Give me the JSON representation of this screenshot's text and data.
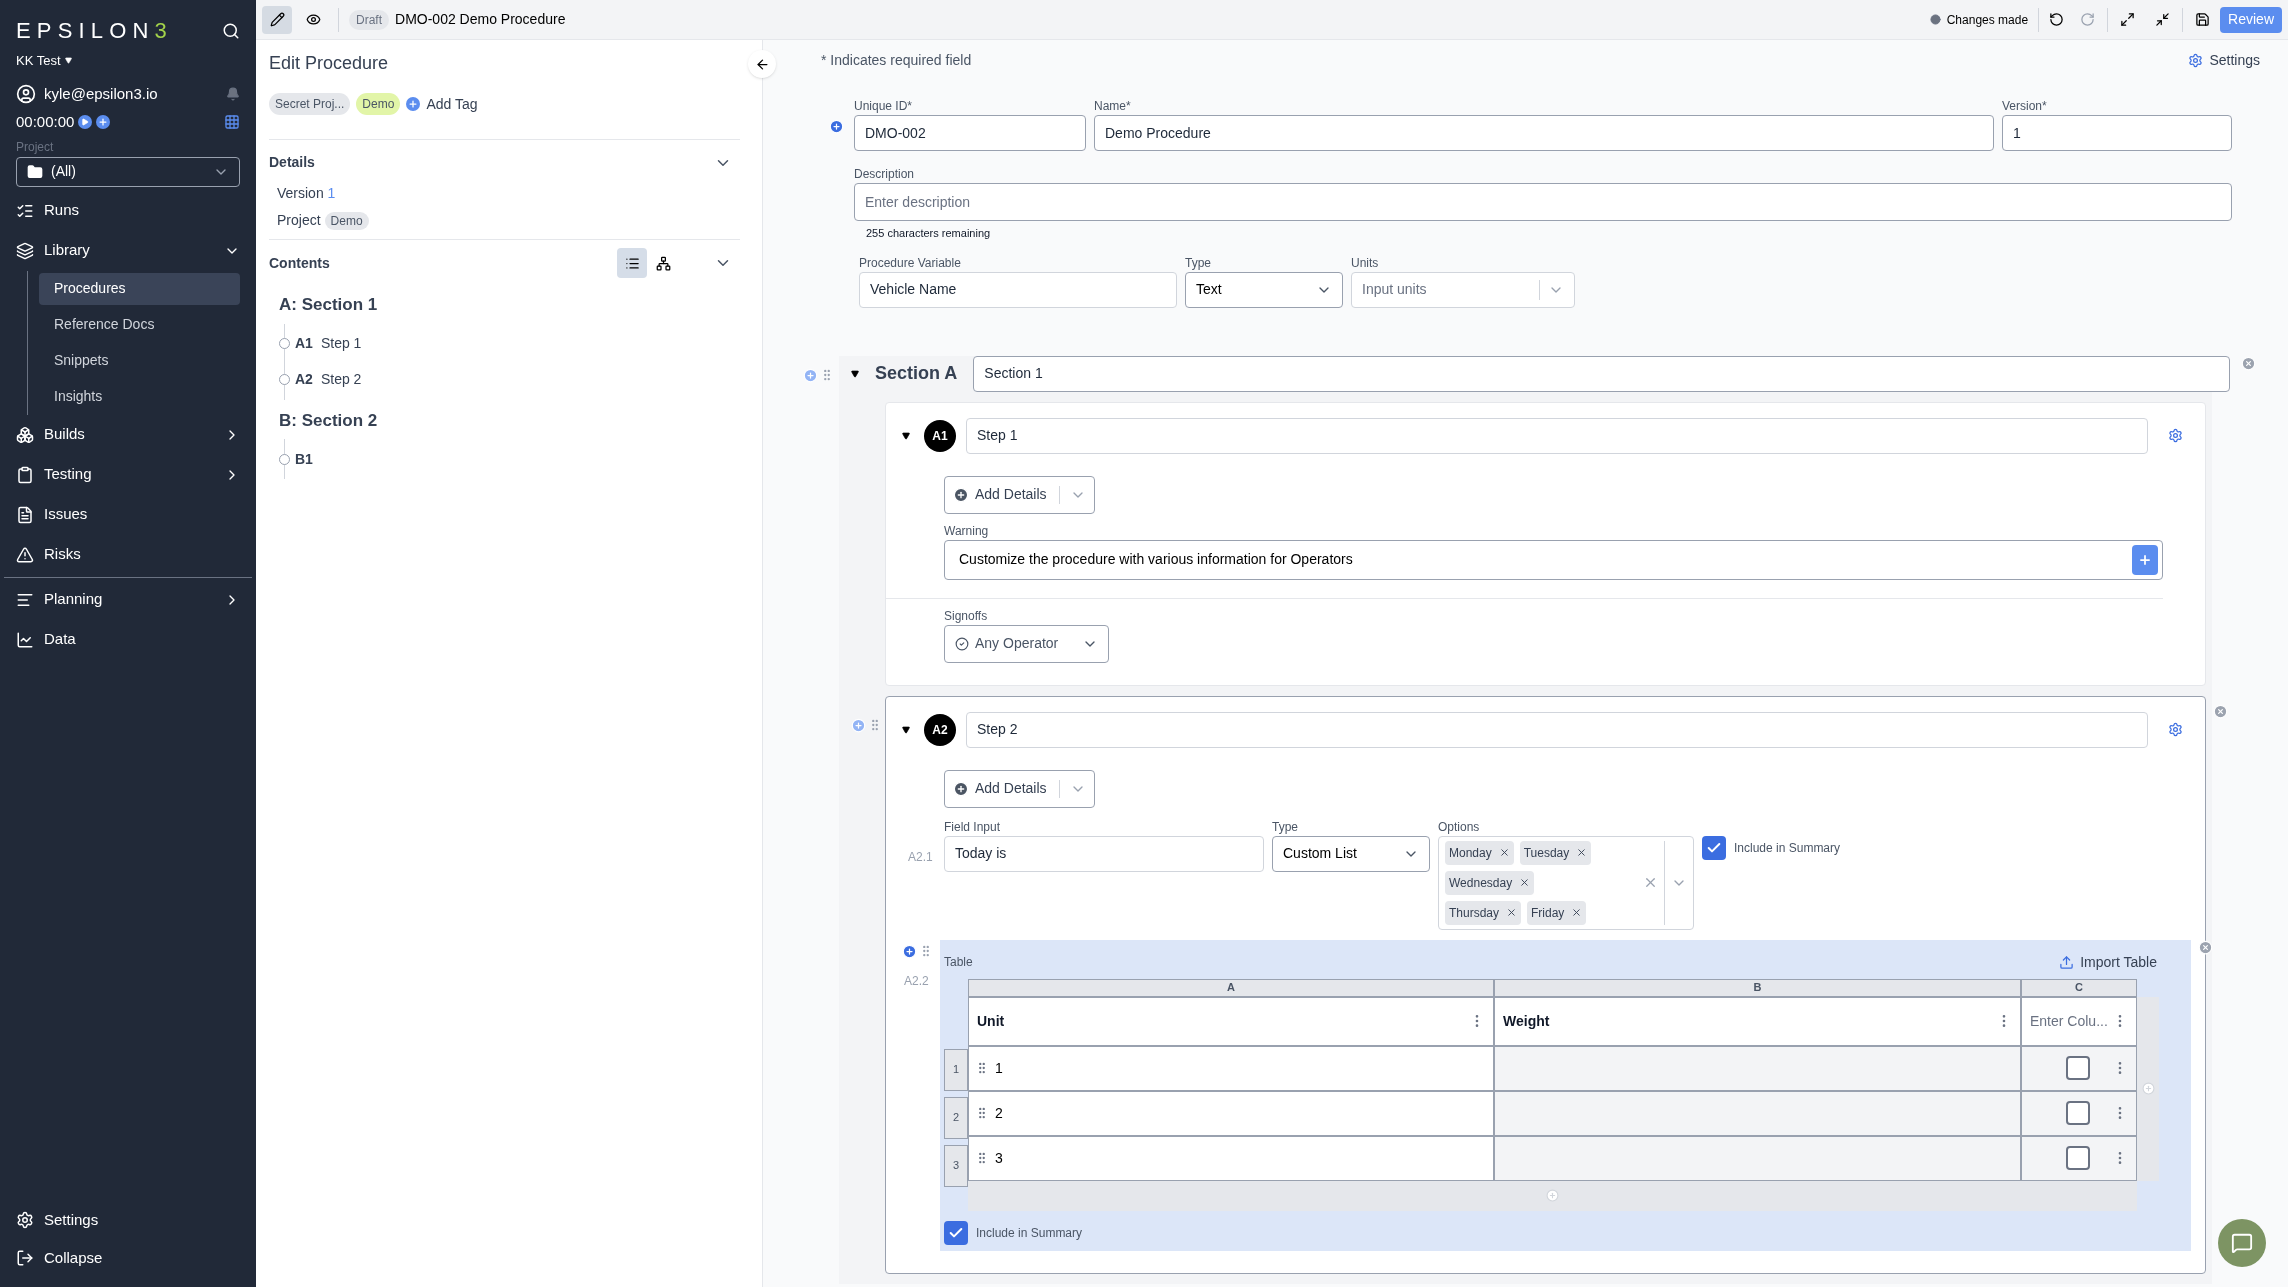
{
  "sidebar": {
    "logo_main": "EPSILON",
    "logo_accent": "3",
    "workspace": "KK Test",
    "user": "kyle@epsilon3.io",
    "timer": "00:00:00",
    "project_label": "Project",
    "project_value": "(All)",
    "nav": [
      {
        "label": "Runs",
        "kind": "link"
      },
      {
        "label": "Library",
        "kind": "group",
        "expanded": true,
        "children": [
          {
            "label": "Procedures",
            "selected": true
          },
          {
            "label": "Reference Docs",
            "selected": false
          },
          {
            "label": "Snippets",
            "selected": false
          },
          {
            "label": "Insights",
            "selected": false
          }
        ]
      },
      {
        "label": "Builds",
        "kind": "group",
        "expanded": false
      },
      {
        "label": "Testing",
        "kind": "group",
        "expanded": false
      },
      {
        "label": "Issues",
        "kind": "link"
      },
      {
        "label": "Risks",
        "kind": "link"
      },
      {
        "label": "Planning",
        "kind": "group",
        "expanded": false
      },
      {
        "label": "Data",
        "kind": "link"
      }
    ],
    "bottom": [
      {
        "label": "Settings"
      },
      {
        "label": "Collapse"
      }
    ]
  },
  "topbar": {
    "modes": [
      {
        "selected": true
      },
      {
        "selected": false
      }
    ],
    "status": "Draft",
    "title": "DMO-002 Demo Procedure",
    "changes": "Changes made",
    "review": "Review"
  },
  "panel": {
    "title": "Edit Procedure",
    "tags": [
      {
        "label": "Secret Proj...",
        "color": "#e5e7eb"
      },
      {
        "label": "Demo",
        "color": "#e2f5a8"
      }
    ],
    "add_tag": "Add Tag",
    "details": {
      "title": "Details",
      "version_label": "Version",
      "version": "1",
      "project_label": "Project",
      "project": "Demo"
    },
    "contents": {
      "title": "Contents",
      "views": [
        {
          "selected": true
        },
        {
          "selected": false
        }
      ],
      "tree": [
        {
          "label": "A: Section 1",
          "children": [
            {
              "id": "A1",
              "label": "Step 1"
            },
            {
              "id": "A2",
              "label": "Step 2"
            }
          ]
        },
        {
          "label": "B: Section 2",
          "children": [
            {
              "id": "B1"
            }
          ]
        }
      ]
    }
  },
  "main": {
    "required_note": "* Indicates required field",
    "settings": "Settings",
    "unique_id": {
      "label": "Unique ID*",
      "value": "DMO-002"
    },
    "name": {
      "label": "Name*",
      "value": "Demo Procedure"
    },
    "version": {
      "label": "Version*",
      "value": "1"
    },
    "description": {
      "label": "Description",
      "placeholder": "Enter description",
      "remaining": "255 characters remaining"
    },
    "variable": {
      "label": "Procedure Variable",
      "value": "Vehicle Name",
      "type_label": "Type",
      "type": "Text",
      "units_label": "Units",
      "units_placeholder": "Input units"
    },
    "section": {
      "label": "Section A",
      "name": "Section 1",
      "steps": [
        {
          "badge": "A1",
          "name": "Step 1",
          "selected": false,
          "add_details": "Add Details",
          "warning_label": "Warning",
          "warning": "Customize the procedure with various information for Operators",
          "signoffs_label": "Signoffs",
          "signoff": "Any Operator"
        },
        {
          "badge": "A2",
          "name": "Step 2",
          "selected": true,
          "add_details": "Add Details",
          "field": {
            "index": "A2.1",
            "label": "Field Input",
            "value": "Today is",
            "type_label": "Type",
            "type": "Custom List",
            "options_label": "Options",
            "options": [
              "Monday",
              "Tuesday",
              "Wednesday",
              "Thursday",
              "Friday"
            ],
            "summary": "Include in Summary",
            "summary_checked": true
          },
          "table": {
            "index": "A2.2",
            "label": "Table",
            "import": "Import Table",
            "columns": [
              {
                "letter": "A",
                "header": "Unit",
                "placeholder": false
              },
              {
                "letter": "B",
                "header": "Weight",
                "placeholder": false
              },
              {
                "letter": "C",
                "header": "Enter Colu...",
                "placeholder": true
              }
            ],
            "rows": [
              {
                "num": "1",
                "value": "1",
                "checked": false
              },
              {
                "num": "2",
                "value": "2",
                "checked": false
              },
              {
                "num": "3",
                "value": "3",
                "checked": false
              }
            ],
            "summary": "Include in Summary",
            "summary_checked": true
          }
        }
      ]
    }
  }
}
